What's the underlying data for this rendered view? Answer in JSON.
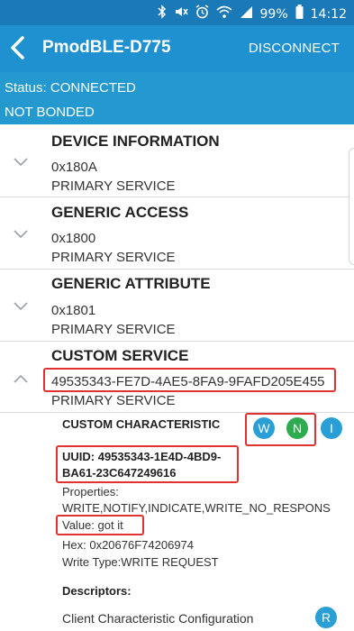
{
  "status_bar": {
    "icons": [
      "bluetooth-icon",
      "mute-icon",
      "alarm-icon",
      "wifi-icon",
      "signal-icon"
    ],
    "battery": "99%",
    "time": "14:12"
  },
  "app_bar": {
    "title": "PmodBLE-D775",
    "action": "DISCONNECT"
  },
  "connection": {
    "status": "Status: CONNECTED",
    "bond": "NOT BONDED"
  },
  "services": [
    {
      "name": "DEVICE INFORMATION",
      "uuid": "0x180A",
      "type": "PRIMARY SERVICE",
      "expanded": false
    },
    {
      "name": "GENERIC ACCESS",
      "uuid": "0x1800",
      "type": "PRIMARY SERVICE",
      "expanded": false
    },
    {
      "name": "GENERIC ATTRIBUTE",
      "uuid": "0x1801",
      "type": "PRIMARY SERVICE",
      "expanded": false
    },
    {
      "name": "CUSTOM SERVICE",
      "uuid": "49535343-FE7D-4AE5-8FA9-9FAFD205E455",
      "type": "PRIMARY SERVICE",
      "expanded": true
    }
  ],
  "characteristic": {
    "name": "CUSTOM CHARACTERISTIC",
    "buttons": [
      {
        "label": "W",
        "color": "#2a9fd6"
      },
      {
        "label": "N",
        "color": "#2eaa4f"
      },
      {
        "label": "I",
        "color": "#2a9fd6"
      }
    ],
    "uuid_line1": "UUID: 49535343-1E4D-4BD9-",
    "uuid_line2": "BA61-23C647249616",
    "properties_label": "Properties:",
    "properties_value": "WRITE,NOTIFY,INDICATE,WRITE_NO_RESPONS",
    "value": "Value: got it",
    "hex": "Hex: 0x20676F74206974",
    "write_type": "Write Type:WRITE REQUEST",
    "descriptors_label": "Descriptors:",
    "descriptor_name": "Client Characteristic Configuration",
    "descriptor_button": {
      "label": "R",
      "color": "#2a9fd6"
    }
  },
  "colors": {
    "status_bar": "#1a7ab7",
    "app_bar": "#1f90d0",
    "info_band": "#2399cf",
    "highlight": "#e0332f"
  }
}
